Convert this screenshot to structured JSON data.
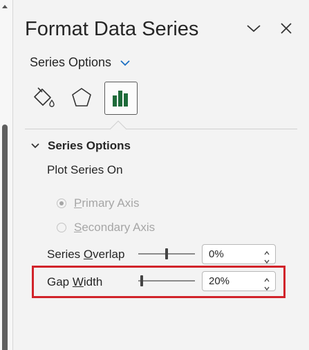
{
  "pane": {
    "title": "Format Data Series",
    "series_dropdown_label": "Series Options",
    "tabs": [
      {
        "name": "fill-line",
        "icon": "paint-bucket-icon",
        "active": false
      },
      {
        "name": "effects",
        "icon": "pentagon-icon",
        "active": false
      },
      {
        "name": "series-options",
        "icon": "bar-chart-icon",
        "active": true
      }
    ],
    "accent_color": "#1e6b3a",
    "highlight_color": "#d1232a"
  },
  "series_options": {
    "header": "Series Options",
    "plot_on_label": "Plot Series On",
    "primary_axis_label": "Primary Axis",
    "secondary_axis_label": "Secondary Axis",
    "selected_axis": "Primary Axis",
    "overlap": {
      "label": "Series Overlap",
      "value": "0%",
      "slider_fraction": 0.5
    },
    "gap_width": {
      "label": "Gap Width",
      "value": "20%",
      "slider_fraction": 0.04
    }
  }
}
